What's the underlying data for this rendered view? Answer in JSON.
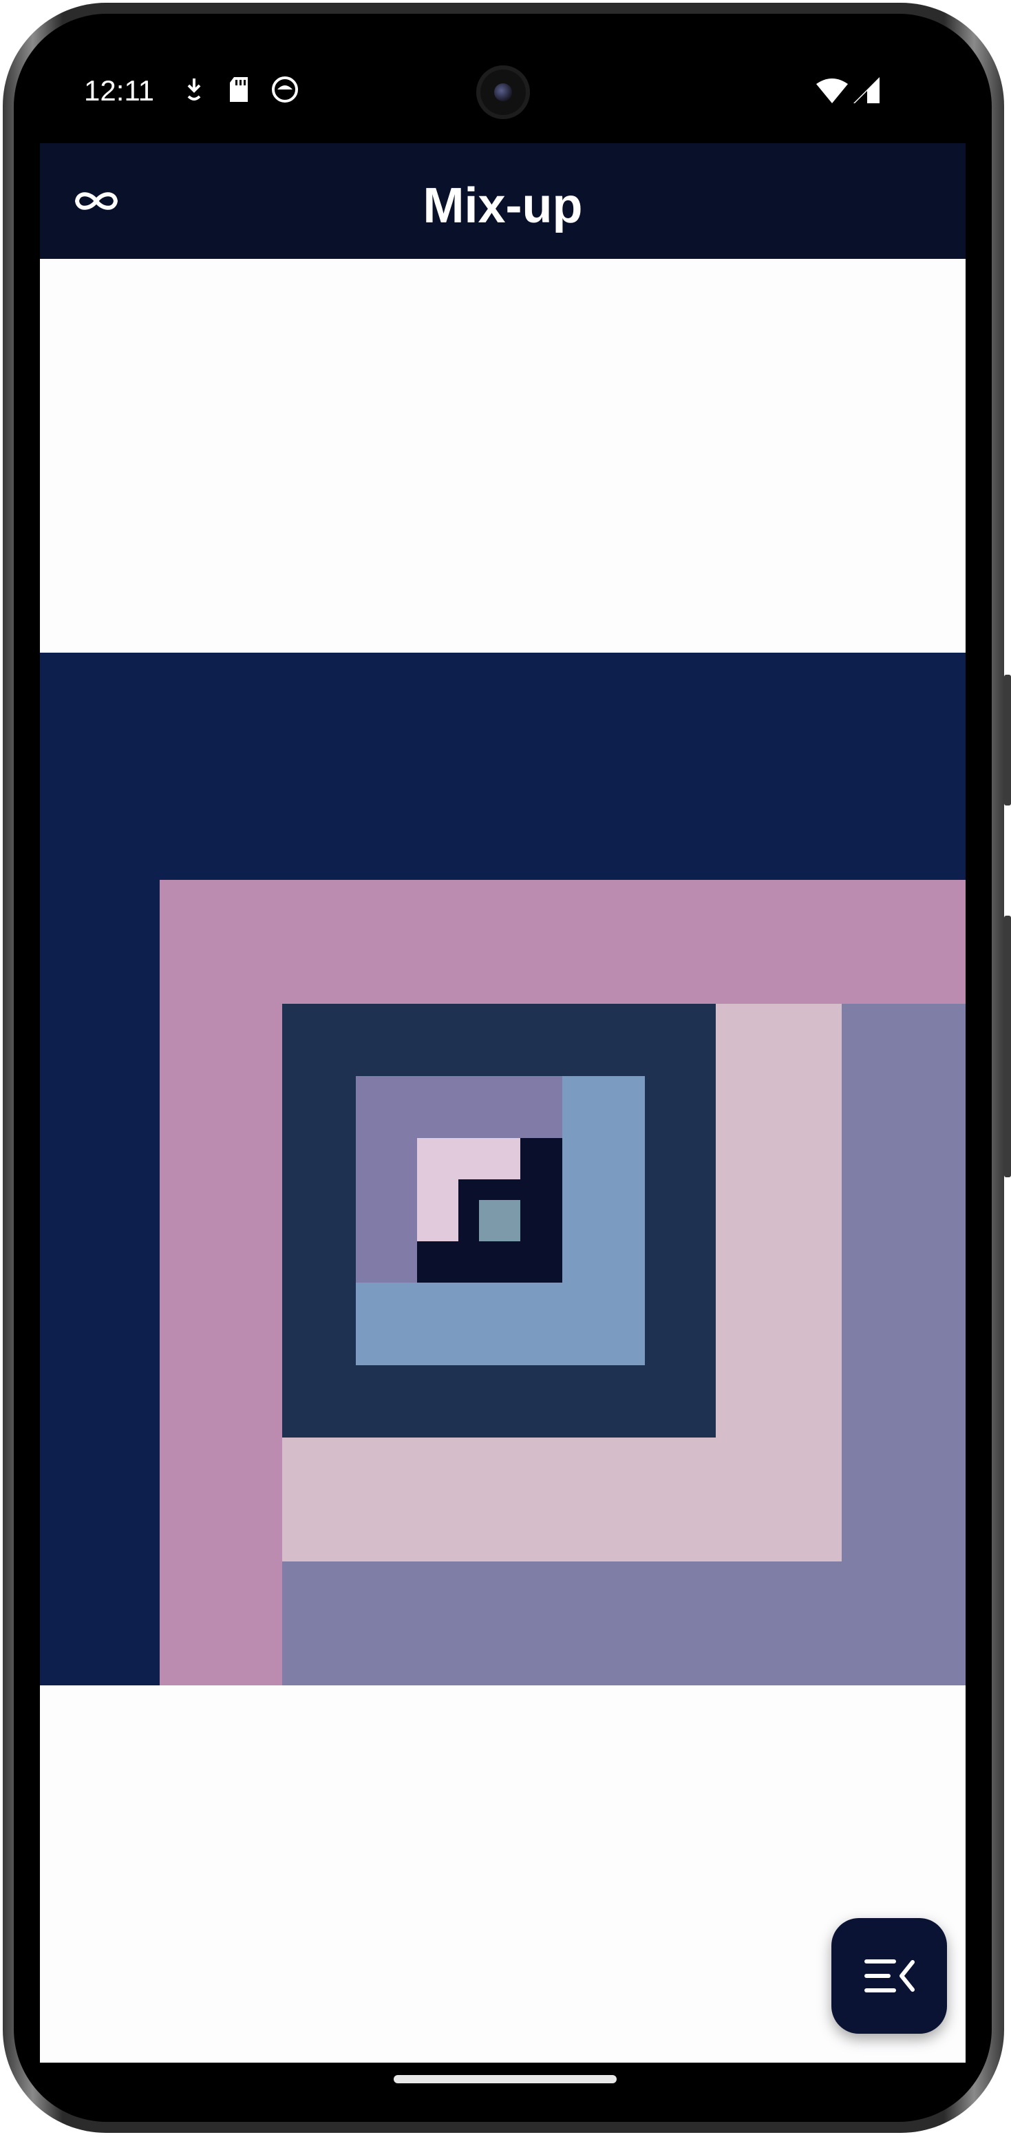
{
  "status_bar": {
    "time": "12:11",
    "left_icons": [
      "download-icon",
      "sd-card-icon",
      "app-notification-icon"
    ],
    "right_icons": [
      "wifi-icon",
      "cell-signal-icon"
    ]
  },
  "app_bar": {
    "title": "Mix-up",
    "leading_icon": "infinity-icon"
  },
  "artwork": {
    "description_colors": {
      "navy": "#0d1f4c",
      "pink": "#bc8bb0",
      "lavender": "#7f7ea6",
      "blush": "#d5bdca",
      "slate": "#1f3150",
      "blue": "#7b9bc1",
      "purple_gray": "#807ca7",
      "light_pink": "#e1cadc",
      "dark_navy": "#0a0f2c",
      "teal_gray": "#7d9aab"
    }
  },
  "fab": {
    "icon": "menu-collapse-icon"
  },
  "colors": {
    "app_bar_bg": "#09102a",
    "screen_bg": "#fdfdfe",
    "fab_bg": "#0b1335"
  }
}
